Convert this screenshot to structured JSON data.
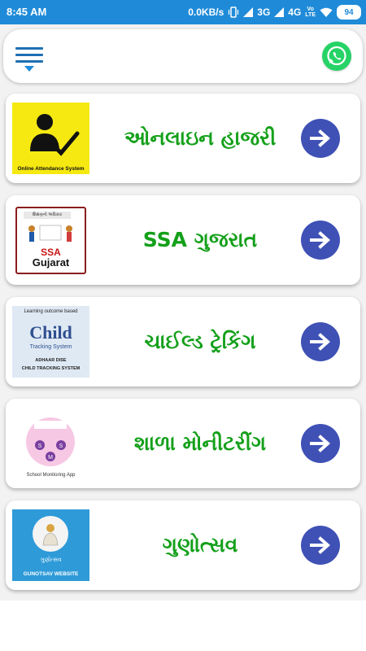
{
  "status_bar": {
    "time": "8:45 AM",
    "speed": "0.0KB/s",
    "net1": "3G",
    "net2": "4G",
    "volte": "Vo",
    "volte2": "LTE",
    "battery": "94"
  },
  "toolbar": {
    "menu_icon": "hamburger-menu-icon",
    "whatsapp_icon": "whatsapp-icon"
  },
  "items": [
    {
      "title": "ઓનલાઇન હાજરી",
      "thumb_caption": "Online Attendance System"
    },
    {
      "title": "SSA ગુજરાત",
      "thumb_header": "શિક્ષણનો અધિકાર",
      "thumb_ssa": "SSA",
      "thumb_gujarat": "Gujarat"
    },
    {
      "title": "ચાઈલ્ડ ટ્રેકિંગ",
      "thumb_top": "Learning outcome based",
      "thumb_child": "Child",
      "thumb_tracking": "Tracking System",
      "thumb_bottom1": "ADHAAR DISE",
      "thumb_bottom2": "CHILD TRACKING SYSTEM"
    },
    {
      "title": "શાળા મોનીટરીંગ",
      "thumb_caption": "School Monitoring App"
    },
    {
      "title": "ગુણોત્સવ",
      "thumb_caption1": "ગુણોત્સવ",
      "thumb_caption2": "GUNOTSAV WEBSITE"
    }
  ],
  "colors": {
    "status_bar": "#1f8bd8",
    "title_green": "#14a01a",
    "arrow_button": "#3f51b5"
  }
}
